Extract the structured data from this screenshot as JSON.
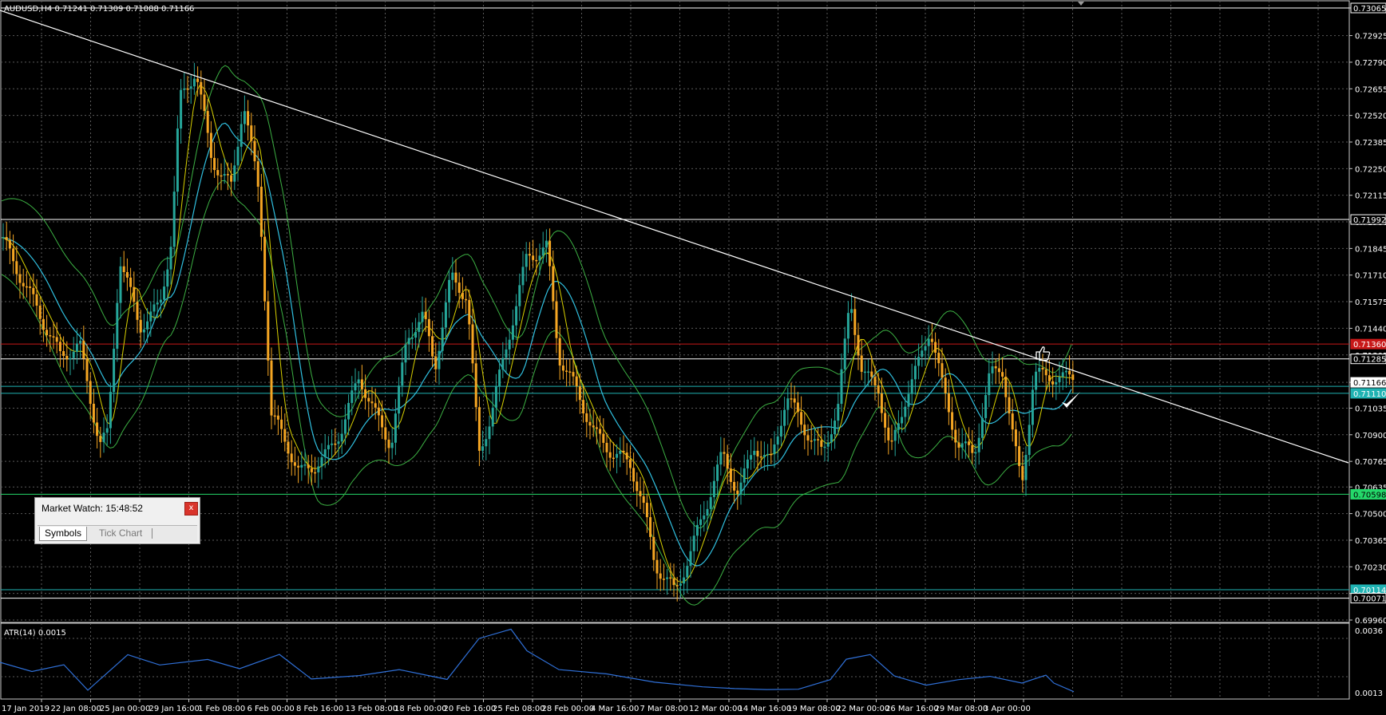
{
  "symbol_header": "AUDUSD,H4  0.71241 0.71309 0.71088 0.71166",
  "atr_header": "ATR(14) 0.0015",
  "price_axis": [
    "0.73065",
    "0.72925",
    "0.72790",
    "0.72655",
    "0.72520",
    "0.72385",
    "0.72250",
    "0.72115",
    "0.71980",
    "0.71845",
    "0.71710",
    "0.71575",
    "0.71440",
    "0.71305",
    "0.71166",
    "0.71035",
    "0.70900",
    "0.70765",
    "0.70635",
    "0.70500",
    "0.70365",
    "0.70230",
    "0.70095",
    "0.69960"
  ],
  "price_tags": [
    {
      "text": "0.73065",
      "bg": "#000000",
      "fg": "#ffffff"
    },
    {
      "text": "0.71992",
      "bg": "#000000",
      "fg": "#ffffff"
    },
    {
      "text": "0.71360",
      "bg": "#c81818",
      "fg": "#ffffff"
    },
    {
      "text": "0.71285",
      "bg": "#000000",
      "fg": "#ffffff"
    },
    {
      "text": "0.71166",
      "bg": "#ffffff",
      "fg": "#000000"
    },
    {
      "text": "0.71110",
      "bg": "#1fb3b3",
      "fg": "#ffffff"
    },
    {
      "text": "0.70598",
      "bg": "#24d86a",
      "fg": "#000000"
    },
    {
      "text": "0.70114",
      "bg": "#1fb3b3",
      "fg": "#ffffff"
    },
    {
      "text": "0.70071",
      "bg": "#000000",
      "fg": "#ffffff"
    }
  ],
  "atr_axis": [
    "0.0036",
    "0.0013"
  ],
  "time_axis": [
    "17 Jan 2019",
    "22 Jan 08:00",
    "25 Jan 00:00",
    "29 Jan 16:00",
    "1 Feb 08:00",
    "6 Feb 00:00",
    "8 Feb 16:00",
    "13 Feb 08:00",
    "18 Feb 00:00",
    "20 Feb 16:00",
    "25 Feb 08:00",
    "28 Feb 00:00",
    "4 Mar 16:00",
    "7 Mar 08:00",
    "12 Mar 00:00",
    "14 Mar 16:00",
    "19 Mar 08:00",
    "22 Mar 00:00",
    "26 Mar 16:00",
    "29 Mar 08:00",
    "3 Apr 00:00"
  ],
  "market_watch": {
    "title": "Market Watch: 15:48:52",
    "close": "x",
    "tab_symbols": "Symbols",
    "tab_tick": "Tick Chart"
  },
  "colors": {
    "bull": "#26a69a",
    "bear": "#f5a623",
    "trendline": "#ffffff",
    "resistance": "#c81818",
    "support": "#24d86a",
    "cyan_level": "#1fb3b3",
    "atr": "#2f6fd6",
    "bands": "#3cb043",
    "ma_slow": "#30c0e0",
    "ma_fast": "#d8d000"
  },
  "icons": [
    "thumbs-up-icon",
    "checkmark-icon"
  ]
}
